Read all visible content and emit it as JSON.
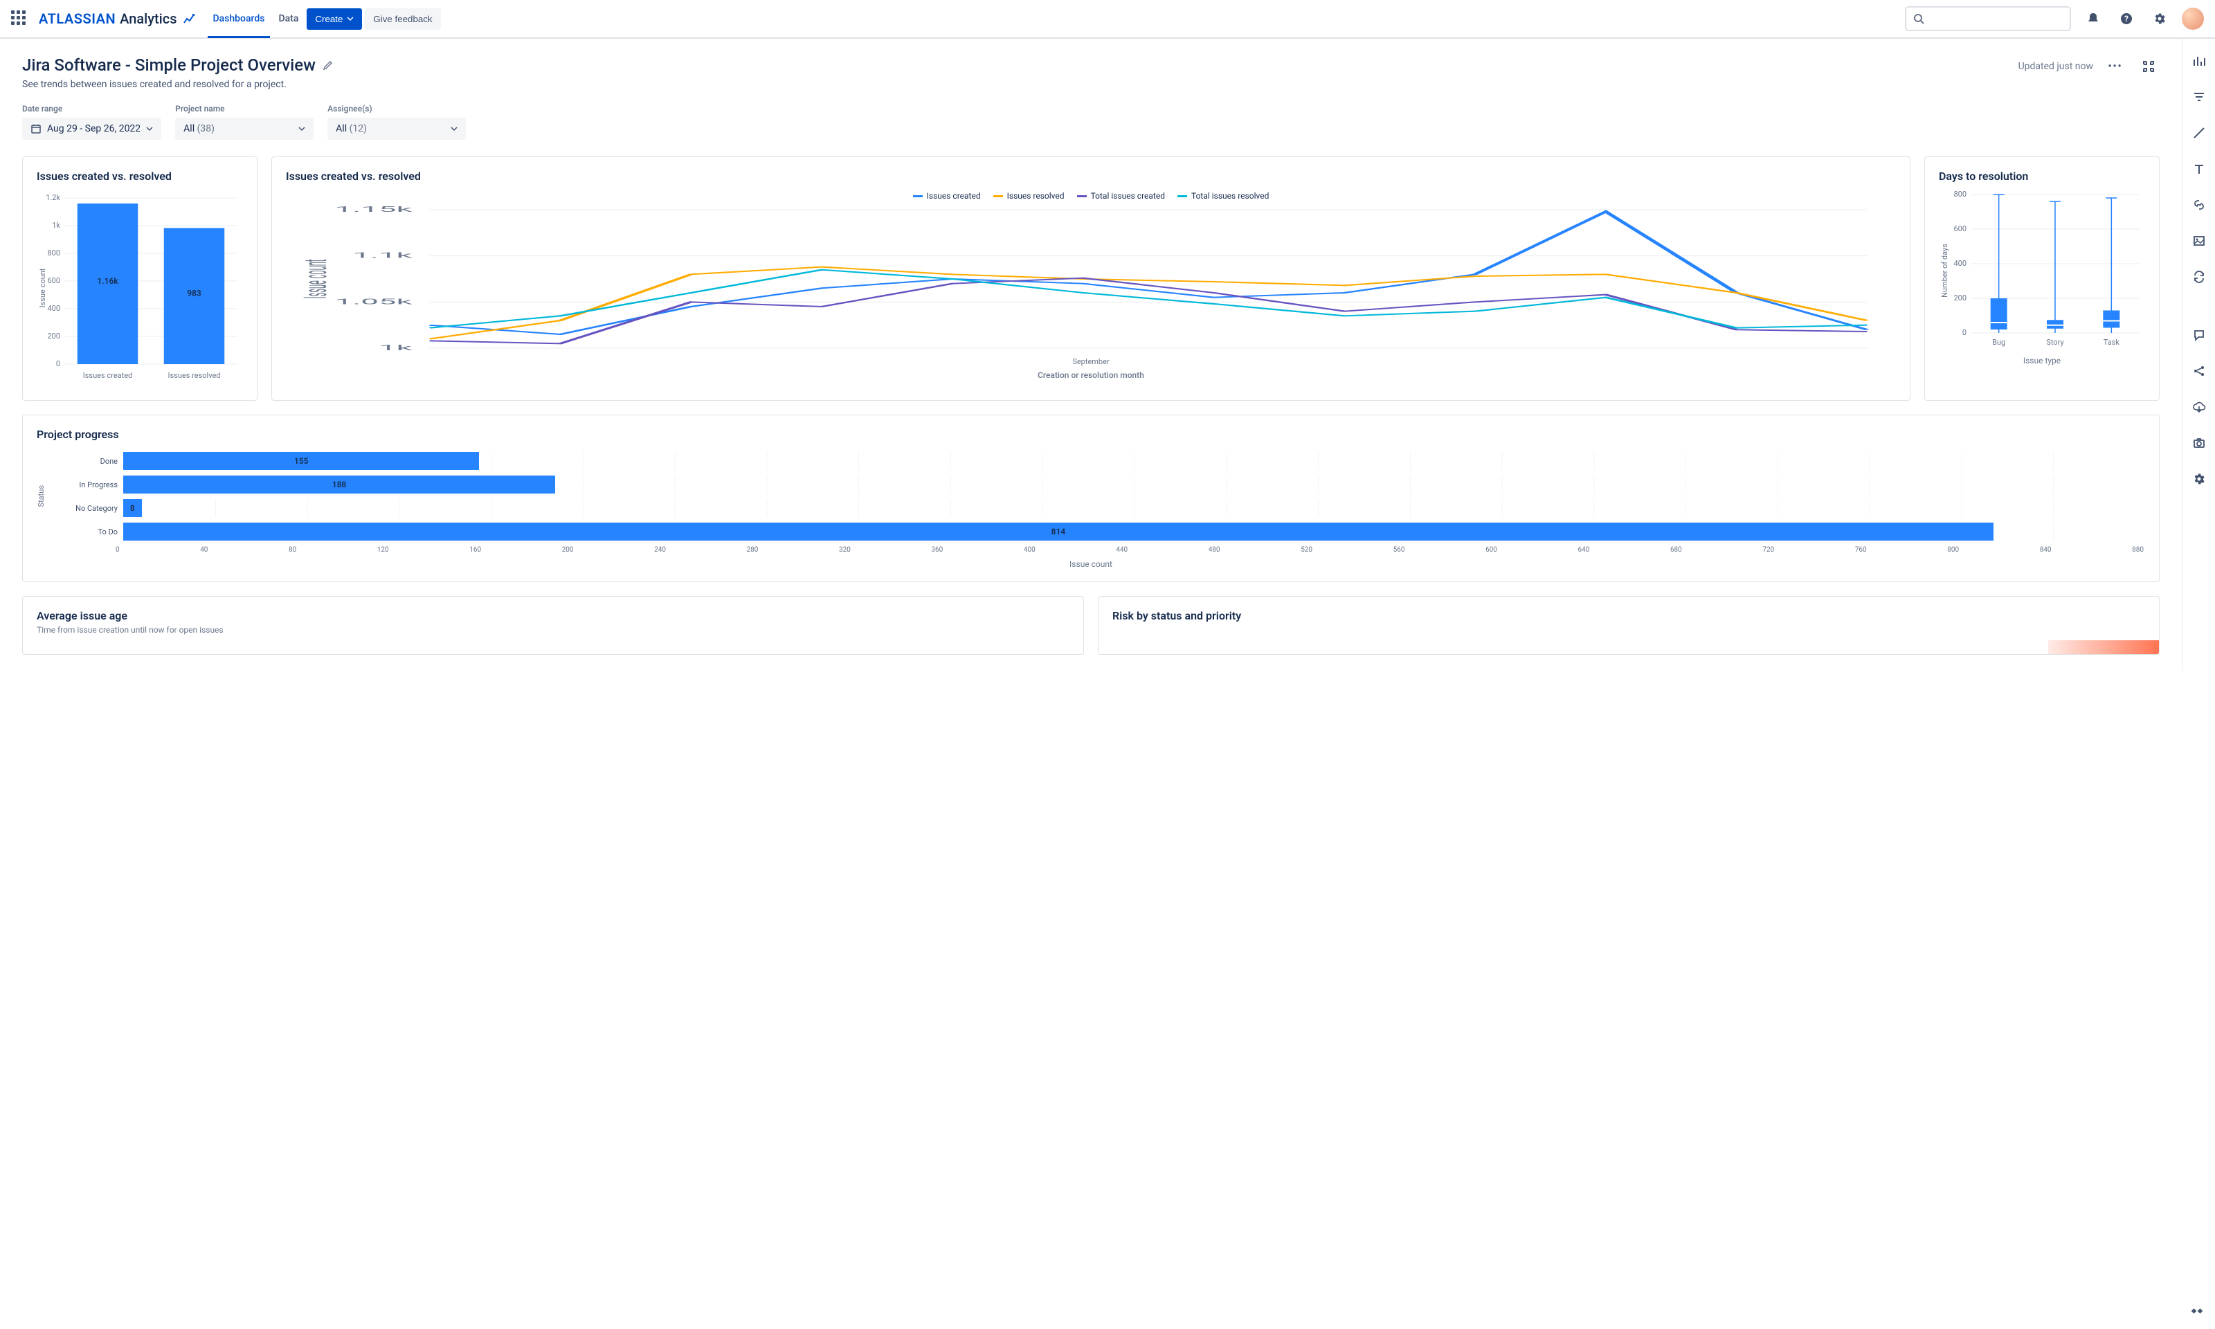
{
  "header": {
    "brand_primary": "ATLASSIAN",
    "brand_secondary": "Analytics",
    "nav": {
      "dashboards": "Dashboards",
      "data": "Data",
      "create": "Create",
      "feedback": "Give feedback"
    }
  },
  "page": {
    "title": "Jira Software - Simple Project Overview",
    "subtitle": "See trends between issues created and resolved for a project.",
    "updated": "Updated just now"
  },
  "filters": {
    "date_range": {
      "label": "Date range",
      "value": "Aug 29 - Sep 26, 2022"
    },
    "project": {
      "label": "Project name",
      "value": "All",
      "count": "(38)"
    },
    "assignee": {
      "label": "Assignee(s)",
      "value": "All",
      "count": "(12)"
    }
  },
  "cards": {
    "bar1": {
      "title": "Issues created vs. resolved"
    },
    "lines": {
      "title": "Issues created vs. resolved",
      "xlabel": "Creation or resolution month",
      "xtick": "September",
      "ylabel": "Issue count",
      "legend": {
        "a": "Issues created",
        "b": "Issues resolved",
        "c": "Total issues created",
        "d": "Total issues resolved"
      }
    },
    "box": {
      "title": "Days to resolution",
      "xlabel": "Issue type",
      "ylabel": "Number of days"
    },
    "hbar": {
      "title": "Project progress",
      "xlabel": "Issue count",
      "ylabel": "Status"
    },
    "age": {
      "title": "Average issue age",
      "sub": "Time from issue creation until now for open issues"
    },
    "risk": {
      "title": "Risk by status and priority"
    }
  },
  "chart_data": [
    {
      "id": "issues_created_vs_resolved_bar",
      "type": "bar",
      "title": "Issues created vs. resolved",
      "ylabel": "Issue count",
      "categories": [
        "Issues created",
        "Issues resolved"
      ],
      "values": [
        1160,
        983
      ],
      "value_labels": [
        "1.16k",
        "983"
      ],
      "ylim": [
        0,
        1200
      ],
      "yticks": [
        0,
        200,
        400,
        600,
        800,
        1000,
        1200
      ],
      "ytick_labels": [
        "0",
        "200",
        "400",
        "600",
        "800",
        "1k",
        "1.2k"
      ]
    },
    {
      "id": "issues_created_vs_resolved_lines",
      "type": "line",
      "title": "Issues created vs. resolved",
      "xlabel": "Creation or resolution month",
      "xticks": [
        "September"
      ],
      "ylabel": "Issue count",
      "ylim": [
        1000,
        1150
      ],
      "yticks": [
        1000,
        1050,
        1100,
        1150
      ],
      "ytick_labels": [
        "1k",
        "1.05k",
        "1.1k",
        "1.15k"
      ],
      "x": [
        0,
        1,
        2,
        3,
        4,
        5,
        6,
        7,
        8,
        9,
        10,
        11
      ],
      "series": [
        {
          "name": "Issues created",
          "color": "#2684FF",
          "values": [
            1025,
            1015,
            1045,
            1065,
            1075,
            1070,
            1055,
            1060,
            1080,
            1148,
            1060,
            1020
          ]
        },
        {
          "name": "Issues resolved",
          "color": "#FFAB00",
          "values": [
            1010,
            1030,
            1080,
            1088,
            1080,
            1075,
            1072,
            1068,
            1078,
            1080,
            1060,
            1030
          ]
        },
        {
          "name": "Total issues created",
          "color": "#6554C0",
          "values": [
            1008,
            1005,
            1050,
            1045,
            1070,
            1076,
            1060,
            1040,
            1050,
            1058,
            1020,
            1018
          ]
        },
        {
          "name": "Total issues resolved",
          "color": "#00B8D9",
          "values": [
            1022,
            1035,
            1060,
            1085,
            1075,
            1060,
            1048,
            1035,
            1040,
            1055,
            1022,
            1025
          ]
        }
      ]
    },
    {
      "id": "days_to_resolution_box",
      "type": "boxplot",
      "title": "Days to resolution",
      "xlabel": "Issue type",
      "ylabel": "Number of days",
      "ylim": [
        0,
        800
      ],
      "yticks": [
        0,
        200,
        400,
        600,
        800
      ],
      "categories": [
        "Bug",
        "Story",
        "Task"
      ],
      "boxes": [
        {
          "min": 0,
          "q1": 20,
          "median": 60,
          "q3": 200,
          "max": 800
        },
        {
          "min": 0,
          "q1": 25,
          "median": 45,
          "q3": 75,
          "max": 760
        },
        {
          "min": 0,
          "q1": 30,
          "median": 70,
          "q3": 130,
          "max": 780
        }
      ]
    },
    {
      "id": "project_progress_hbar",
      "type": "bar_horizontal",
      "title": "Project progress",
      "xlabel": "Issue count",
      "ylabel": "Status",
      "xlim": [
        0,
        880
      ],
      "xticks": [
        0,
        40,
        80,
        120,
        160,
        200,
        240,
        280,
        320,
        360,
        400,
        440,
        480,
        520,
        560,
        600,
        640,
        680,
        720,
        760,
        800,
        840,
        880
      ],
      "categories": [
        "Done",
        "In Progress",
        "No Category",
        "To Do"
      ],
      "values": [
        155,
        188,
        8,
        814
      ]
    }
  ]
}
